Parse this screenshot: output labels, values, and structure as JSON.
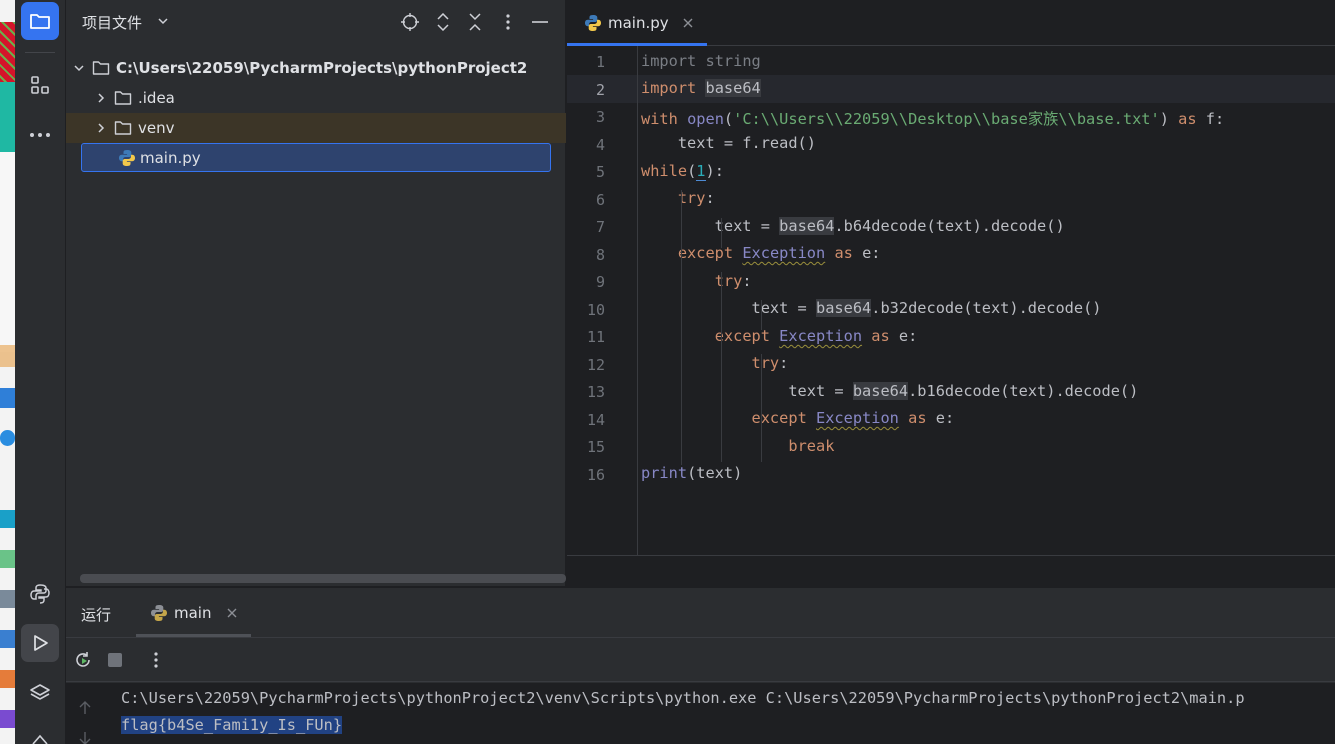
{
  "project_panel": {
    "title": "项目文件",
    "root": "C:\\Users\\22059\\PycharmProjects\\pythonProject2",
    "items": [
      {
        "label": ".idea",
        "type": "folder"
      },
      {
        "label": "venv",
        "type": "folder"
      },
      {
        "label": "main.py",
        "type": "python-file"
      }
    ]
  },
  "editor": {
    "tab_label": "main.py",
    "current_line": 2,
    "line_numbers": [
      "1",
      "2",
      "3",
      "4",
      "5",
      "6",
      "7",
      "8",
      "9",
      "10",
      "11",
      "12",
      "13",
      "14",
      "15",
      "16"
    ]
  },
  "code": {
    "l1_kw": "import",
    "l1_mod": "string",
    "l2_kw": "import",
    "l2_mod": "base64",
    "l3_kw": "with",
    "l3_fn": "open",
    "l3_p1": "(",
    "l3_str": "'C:\\\\Users\\\\22059\\\\Desktop\\\\base家族\\\\base.txt'",
    "l3_p2": ") ",
    "l3_as": "as",
    "l3_rest": " f:",
    "l4": "    text = f.read()",
    "l5_kw": "while",
    "l5_p1": "(",
    "l5_num": "1",
    "l5_p2": "):",
    "l6_kw": "try",
    "l6_rest": ":",
    "l7_a": "        text = ",
    "l7_mod": "base64",
    "l7_rest": ".b64decode(text).decode()",
    "l8_kw": "except",
    "l8_cls": "Exception",
    "l8_as": "as",
    "l8_rest": " e:",
    "l9_kw": "try",
    "l9_rest": ":",
    "l10_a": "            text = ",
    "l10_mod": "base64",
    "l10_rest": ".b32decode(text).decode()",
    "l11_kw": "except",
    "l11_cls": "Exception",
    "l11_as": "as",
    "l11_rest": " e:",
    "l12_kw": "try",
    "l12_rest": ":",
    "l13_a": "                text = ",
    "l13_mod": "base64",
    "l13_rest": ".b16decode(text).decode()",
    "l14_kw": "except",
    "l14_cls": "Exception",
    "l14_as": "as",
    "l14_rest": " e:",
    "l15_kw": "break",
    "l16_fn": "print",
    "l16_rest": "(text)"
  },
  "run_panel": {
    "label": "运行",
    "tab_label": "main",
    "console_lines": [
      "C:\\Users\\22059\\PycharmProjects\\pythonProject2\\venv\\Scripts\\python.exe C:\\Users\\22059\\PycharmProjects\\pythonProject2\\main.p",
      "flag{b4Se_Fami1y_Is_FUn}"
    ]
  },
  "colors": {
    "accent": "#3574f0",
    "keyword": "#cf8e6d",
    "string": "#6aab73",
    "number": "#2aacb8",
    "builtin": "#8888c6",
    "selection": "#214283"
  }
}
